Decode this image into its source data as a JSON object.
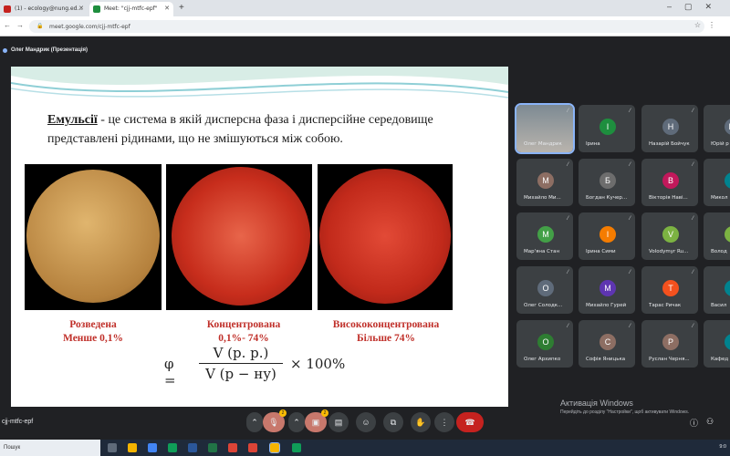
{
  "browser": {
    "tabs": [
      {
        "label": "(1) - ecology@nung.ed...",
        "color": "#c5221f"
      },
      {
        "label": "Meet: \"cjj-mtfc-epf\"",
        "color": "#1e8e3e"
      }
    ],
    "url": "meet.google.com/cjj-mtfc-epf"
  },
  "meet": {
    "presenter_label": "Олег Мандрик (Презентація)",
    "meeting_code": "cjj-mtfc-epf",
    "windows_activation": {
      "title": "Активація Windows",
      "subtitle": "Перейдіть до розділу \"Настройки\", щоб активувати Windows."
    },
    "participants": [
      {
        "name": "Олег Мандрик",
        "initial": "",
        "color": "#5f6368",
        "active": true
      },
      {
        "name": "Ірина",
        "initial": "I",
        "color": "#1e8e3e"
      },
      {
        "name": "Назарій Бойчук",
        "initial": "Н",
        "color": "#5f6b7a"
      },
      {
        "name": "Юрій р",
        "initial": "Ю",
        "color": "#5f6b7a"
      },
      {
        "name": "Михайло Ми...",
        "initial": "М",
        "color": "#8d6e63"
      },
      {
        "name": "Богдан Кучер...",
        "initial": "Б",
        "color": "#6d6d6d"
      },
      {
        "name": "Вікторія Наві...",
        "initial": "В",
        "color": "#c2185b"
      },
      {
        "name": "Микол",
        "initial": "М",
        "color": "#00838f"
      },
      {
        "name": "Мар'яна Стан",
        "initial": "M",
        "color": "#43a047"
      },
      {
        "name": "Ірина Сими",
        "initial": "I",
        "color": "#f57c00"
      },
      {
        "name": "Volodymyr Ru...",
        "initial": "V",
        "color": "#7cb342"
      },
      {
        "name": "Волод",
        "initial": "В",
        "color": "#7cb342"
      },
      {
        "name": "Олег Солодк...",
        "initial": "О",
        "color": "#5f6b7a"
      },
      {
        "name": "Михайло Гурей",
        "initial": "М",
        "color": "#5e35b1"
      },
      {
        "name": "Тарас Ричак",
        "initial": "Т",
        "color": "#f4511e"
      },
      {
        "name": "Васил",
        "initial": "В",
        "color": "#00838f"
      },
      {
        "name": "Олег Архипко",
        "initial": "О",
        "color": "#2e7d32"
      },
      {
        "name": "Софія Яницька",
        "initial": "С",
        "color": "#8d6e63"
      },
      {
        "name": "Руслан Черня...",
        "initial": "Р",
        "color": "#8d6e63"
      },
      {
        "name": "Кафед",
        "initial": "К",
        "color": "#00838f"
      }
    ],
    "controls": {
      "mic_badge": "2",
      "cam_badge": "2"
    }
  },
  "slide": {
    "term": "Емульсії",
    "definition": " - це система в якій дисперсна фаза і дисперсійне середовище представлені рідинами, що не змішуються між собою.",
    "images": [
      {
        "caption_line1": "Розведена",
        "caption_line2": "Менше 0,1%",
        "color": "#c79a5a"
      },
      {
        "caption_line1": "Концентрована",
        "caption_line2": "0,1%- 74%",
        "color": "#d8432b"
      },
      {
        "caption_line1": "Висококонцентрована",
        "caption_line2": "Більше 74%",
        "color": "#d23a2a"
      }
    ],
    "formula": {
      "lhs": "φ =",
      "numerator": "V (р. р.)",
      "denominator": "V (р − ну)",
      "rhs": "× 100%"
    }
  },
  "taskbar": {
    "search_placeholder": "Пошук",
    "time": "9:0"
  }
}
